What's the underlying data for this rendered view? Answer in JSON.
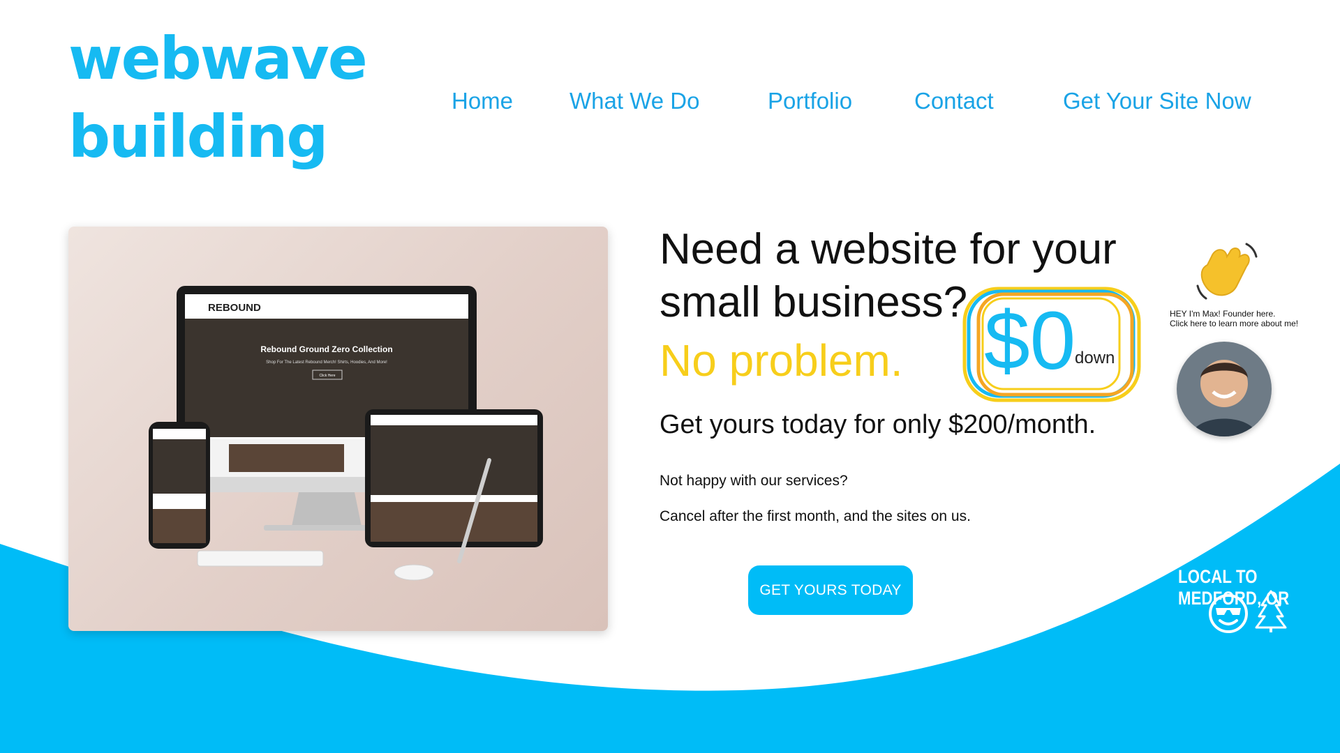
{
  "logo": {
    "line1": "webwave",
    "line2": "building"
  },
  "nav": {
    "items": [
      "Home",
      "What We Do",
      "Portfolio",
      "Contact",
      "Get Your Site Now"
    ]
  },
  "hero": {
    "headline_line1": "Need a website for your",
    "headline_line2": "small business?",
    "highlight": "No problem.",
    "price": "$0",
    "price_sub": "down",
    "subheadline": "Get yours today for only $200/month.",
    "note1": "Not happy with our services?",
    "note2": "Cancel after the first month, and the sites on us.",
    "cta": "GET YOURS TODAY"
  },
  "mockup": {
    "brand": "REBOUND",
    "hero_title": "Rebound Ground Zero Collection",
    "hero_sub": "Shop For The Latest Rebound Merch! Shirts, Hoodies, And More!",
    "button": "Click Here"
  },
  "founder": {
    "line1": "HEY I'm Max! Founder here.",
    "line2": "Click here to learn more about me!"
  },
  "local": {
    "text": "LOCAL TO MEDFORD, OR"
  },
  "colors": {
    "brand_blue": "#16baf2",
    "wave_blue": "#00bcf7",
    "yellow": "#f7ce1b",
    "orange": "#f5a623"
  },
  "icons": [
    "waving-hand-icon",
    "sunglasses-smiley-icon",
    "pine-tree-icon"
  ]
}
